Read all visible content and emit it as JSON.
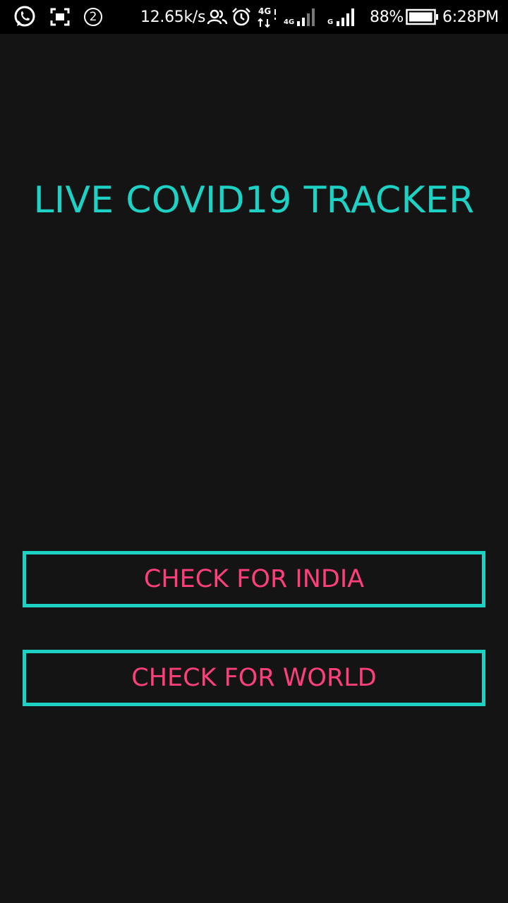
{
  "status_bar": {
    "notification_count": "2",
    "network_speed": "12.65k/s",
    "volte_label": "4G",
    "sim1_label": "4G",
    "sim2_label": "G",
    "battery_percent": "88%",
    "battery_level": 0.88,
    "time": "6:28PM",
    "icons": [
      "whatsapp-icon",
      "screenshot-icon",
      "notification-count-icon",
      "people-icon",
      "alarm-icon",
      "data-transfer-icon",
      "signal-icon",
      "battery-icon"
    ]
  },
  "main": {
    "title": "LIVE COVID19 TRACKER",
    "buttons": [
      {
        "label": "CHECK FOR INDIA"
      },
      {
        "label": "CHECK FOR WORLD"
      }
    ]
  },
  "colors": {
    "background": "#141414",
    "status_bar": "#000000",
    "accent_teal": "#1dd2c4",
    "button_text_pink": "#ff3f7a"
  }
}
